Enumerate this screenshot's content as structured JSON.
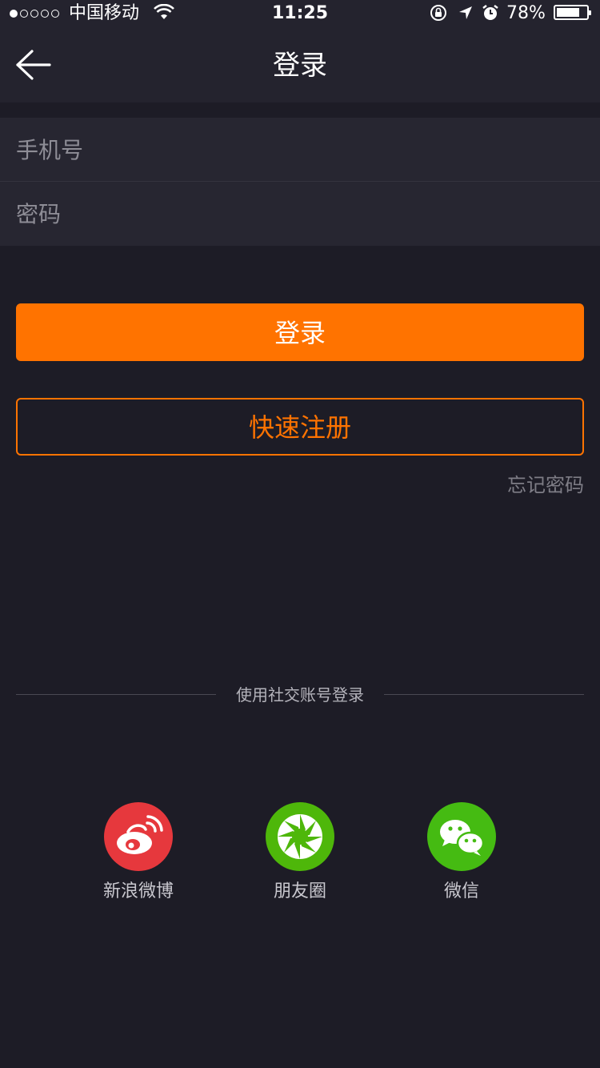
{
  "status_bar": {
    "carrier": "中国移动",
    "time": "11:25",
    "battery_percent": "78%",
    "battery_level": 0.78,
    "signal_bars": 1,
    "signal_total": 5
  },
  "nav": {
    "title": "登录",
    "back_icon": "arrow-left-icon"
  },
  "form": {
    "phone": {
      "placeholder": "手机号",
      "value": ""
    },
    "password": {
      "placeholder": "密码",
      "value": ""
    }
  },
  "actions": {
    "login_label": "登录",
    "register_label": "快速注册",
    "forgot_label": "忘记密码"
  },
  "social": {
    "divider_text": "使用社交账号登录",
    "items": [
      {
        "label": "新浪微博",
        "icon": "weibo-icon",
        "color": "#e6383d"
      },
      {
        "label": "朋友圈",
        "icon": "moments-icon",
        "color": "#4eb70a"
      },
      {
        "label": "微信",
        "icon": "wechat-icon",
        "color": "#45bb12"
      }
    ]
  },
  "colors": {
    "accent": "#ff7300",
    "background": "#1d1c26",
    "bar": "#24232e",
    "input_bg": "#272631"
  }
}
